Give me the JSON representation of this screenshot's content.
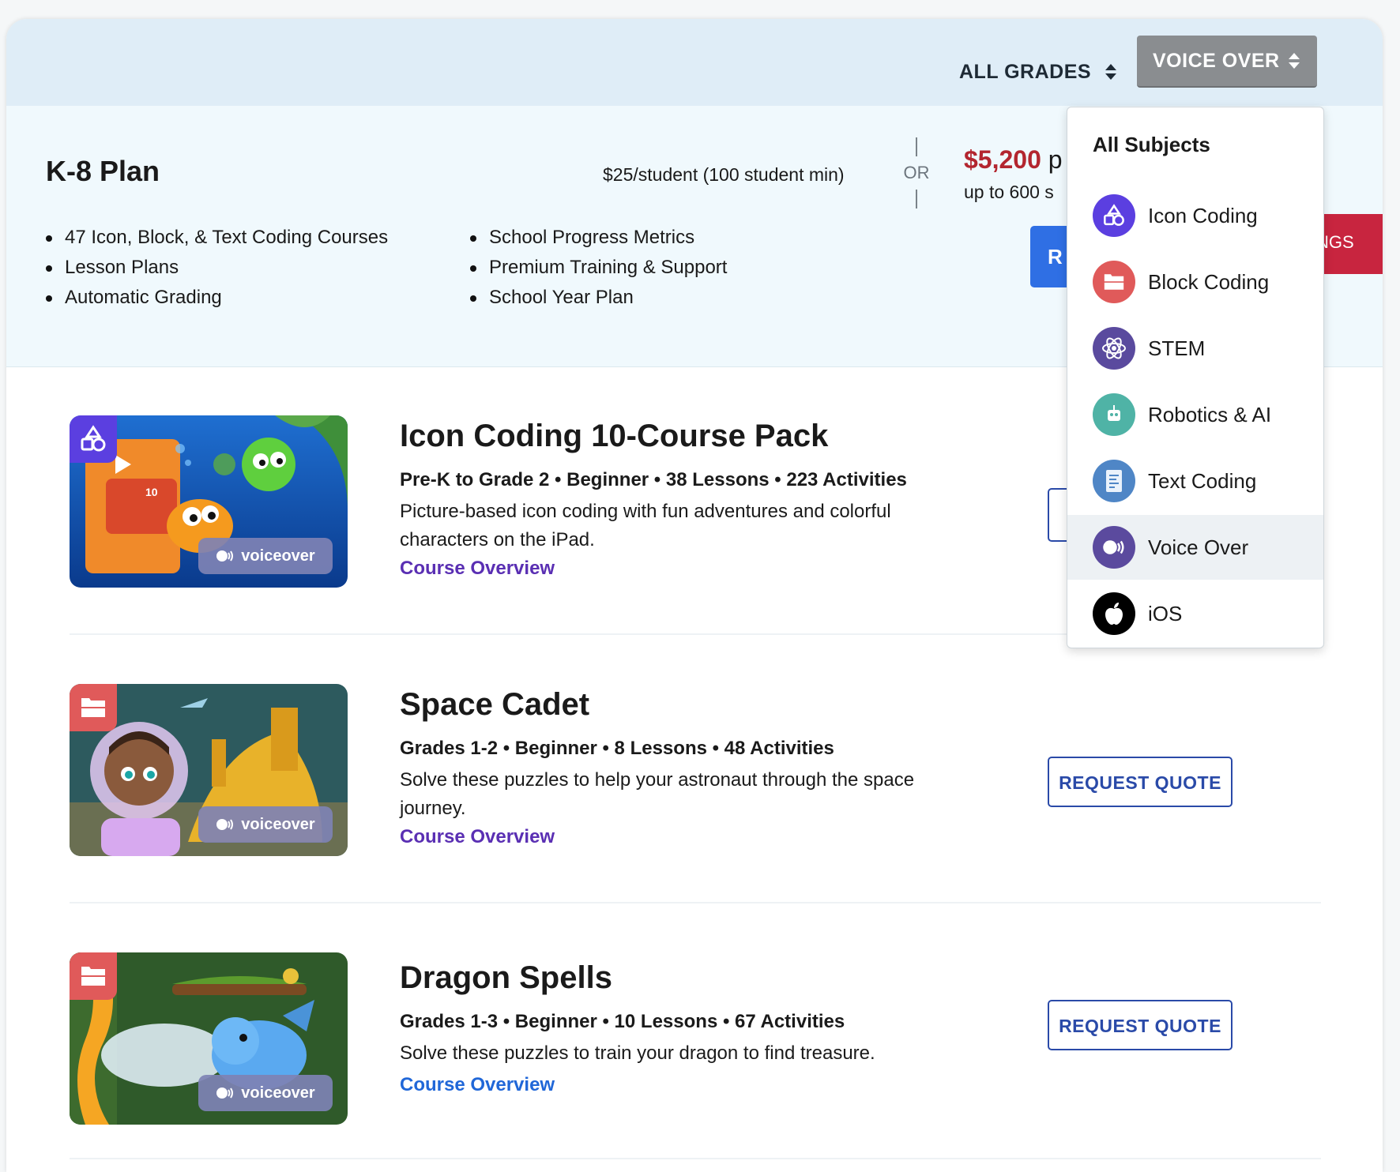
{
  "filters": {
    "grades_label": "ALL GRADES",
    "subject_label": "VOICE OVER"
  },
  "plan": {
    "title": "K-8 Plan",
    "price_per_student": "$25/student (100 student min)",
    "or_text": "OR",
    "price_flat": "$5,200",
    "price_flat_suffix": "p",
    "flat_sub": "up to 600 s",
    "features_left": [
      "47 Icon, Block, & Text Coding Courses",
      "Lesson Plans",
      "Automatic Grading"
    ],
    "features_right": [
      "School Progress Metrics",
      "Premium Training & Support",
      "School Year Plan"
    ],
    "blue_button_partial": "R",
    "red_button_partial": "NGS"
  },
  "dropdown": {
    "header": "All Subjects",
    "items": [
      {
        "label": "Icon Coding",
        "icon": "icon-coding-icon",
        "color": "#5b3fe0"
      },
      {
        "label": "Block Coding",
        "icon": "block-coding-icon",
        "color": "#e05a5a"
      },
      {
        "label": "STEM",
        "icon": "atom-icon",
        "color": "#5a4a9e"
      },
      {
        "label": "Robotics & AI",
        "icon": "robot-icon",
        "color": "#4fb3a6"
      },
      {
        "label": "Text Coding",
        "icon": "code-document-icon",
        "color": "#4f86c6"
      },
      {
        "label": "Voice Over",
        "icon": "voiceover-icon",
        "color": "#5b4a9e",
        "active": true
      },
      {
        "label": "iOS",
        "icon": "apple-icon",
        "color": "#000000"
      }
    ]
  },
  "courses": [
    {
      "title": "Icon Coding 10-Course Pack",
      "meta": "Pre-K to Grade 2 • Beginner • 38 Lessons • 223 Activities",
      "desc": "Picture-based icon coding with fun adventures and colorful characters on the iPad.",
      "link": "Course Overview",
      "badge_label": "voiceover",
      "thumb_text": "10",
      "category_color": "#5b3fe0"
    },
    {
      "title": "Space Cadet",
      "meta": "Grades 1-2 • Beginner • 8 Lessons • 48 Activities",
      "desc": "Solve these puzzles to help your astronaut through the space journey.",
      "link": "Course Overview",
      "badge_label": "voiceover",
      "button": "REQUEST QUOTE",
      "category_color": "#e05a5a"
    },
    {
      "title": "Dragon Spells",
      "meta": "Grades 1-3 • Beginner • 10 Lessons • 67 Activities",
      "desc": "Solve these puzzles to train your dragon to find treasure.",
      "link": "Course Overview",
      "badge_label": "voiceover",
      "button": "REQUEST QUOTE",
      "category_color": "#e05a5a"
    }
  ]
}
